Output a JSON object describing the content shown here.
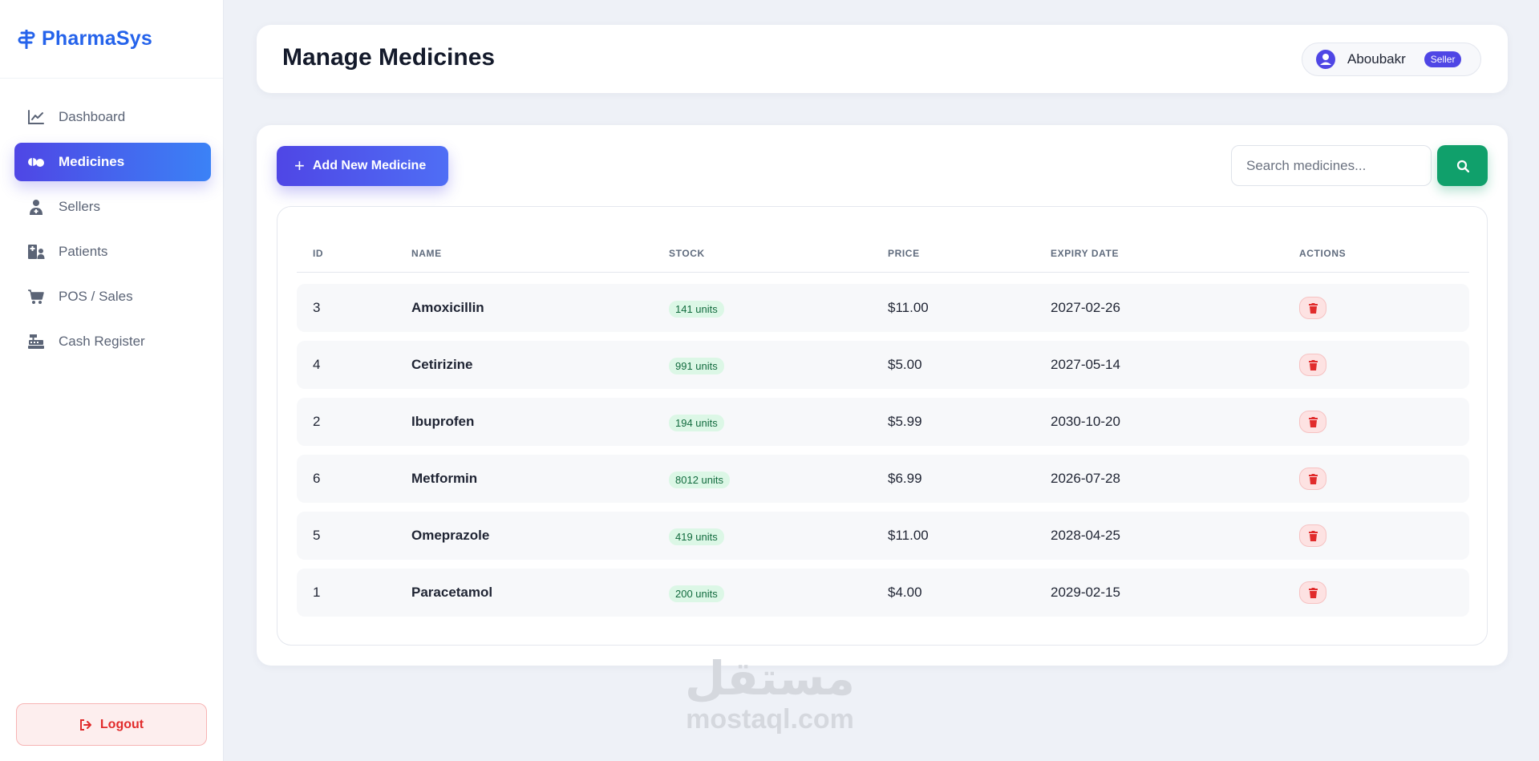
{
  "brand": {
    "name": "PharmaSys",
    "color": "#2563eb"
  },
  "sidebar": {
    "items": [
      {
        "label": "Dashboard",
        "icon": "chart-line-icon",
        "active": false
      },
      {
        "label": "Medicines",
        "icon": "pills-icon",
        "active": true
      },
      {
        "label": "Sellers",
        "icon": "user-doctor-icon",
        "active": false
      },
      {
        "label": "Patients",
        "icon": "hospital-user-icon",
        "active": false
      },
      {
        "label": "POS / Sales",
        "icon": "cart-icon",
        "active": false
      },
      {
        "label": "Cash Register",
        "icon": "cash-register-icon",
        "active": false
      }
    ],
    "logout_label": "Logout"
  },
  "header": {
    "title": "Manage Medicines",
    "user": {
      "name": "Aboubakr",
      "role": "Seller"
    }
  },
  "toolbar": {
    "add_label": "Add New Medicine",
    "search_placeholder": "Search medicines..."
  },
  "table": {
    "columns": [
      "ID",
      "NAME",
      "STOCK",
      "PRICE",
      "EXPIRY DATE",
      "ACTIONS"
    ],
    "rows": [
      {
        "id": "3",
        "name": "Amoxicillin",
        "stock": "141 units",
        "price": "$11.00",
        "expiry": "2027-02-26"
      },
      {
        "id": "4",
        "name": "Cetirizine",
        "stock": "991 units",
        "price": "$5.00",
        "expiry": "2027-05-14"
      },
      {
        "id": "2",
        "name": "Ibuprofen",
        "stock": "194 units",
        "price": "$5.99",
        "expiry": "2030-10-20"
      },
      {
        "id": "6",
        "name": "Metformin",
        "stock": "8012 units",
        "price": "$6.99",
        "expiry": "2026-07-28"
      },
      {
        "id": "5",
        "name": "Omeprazole",
        "stock": "419 units",
        "price": "$11.00",
        "expiry": "2028-04-25"
      },
      {
        "id": "1",
        "name": "Paracetamol",
        "stock": "200 units",
        "price": "$4.00",
        "expiry": "2029-02-15"
      }
    ]
  },
  "watermark": {
    "glyph": "مستقل",
    "text": "mostaql.com"
  },
  "colors": {
    "accent": "#4f46e5",
    "search_button": "#10a06b",
    "danger": "#e12b2b",
    "stock_badge_bg": "#dcf7e6"
  }
}
